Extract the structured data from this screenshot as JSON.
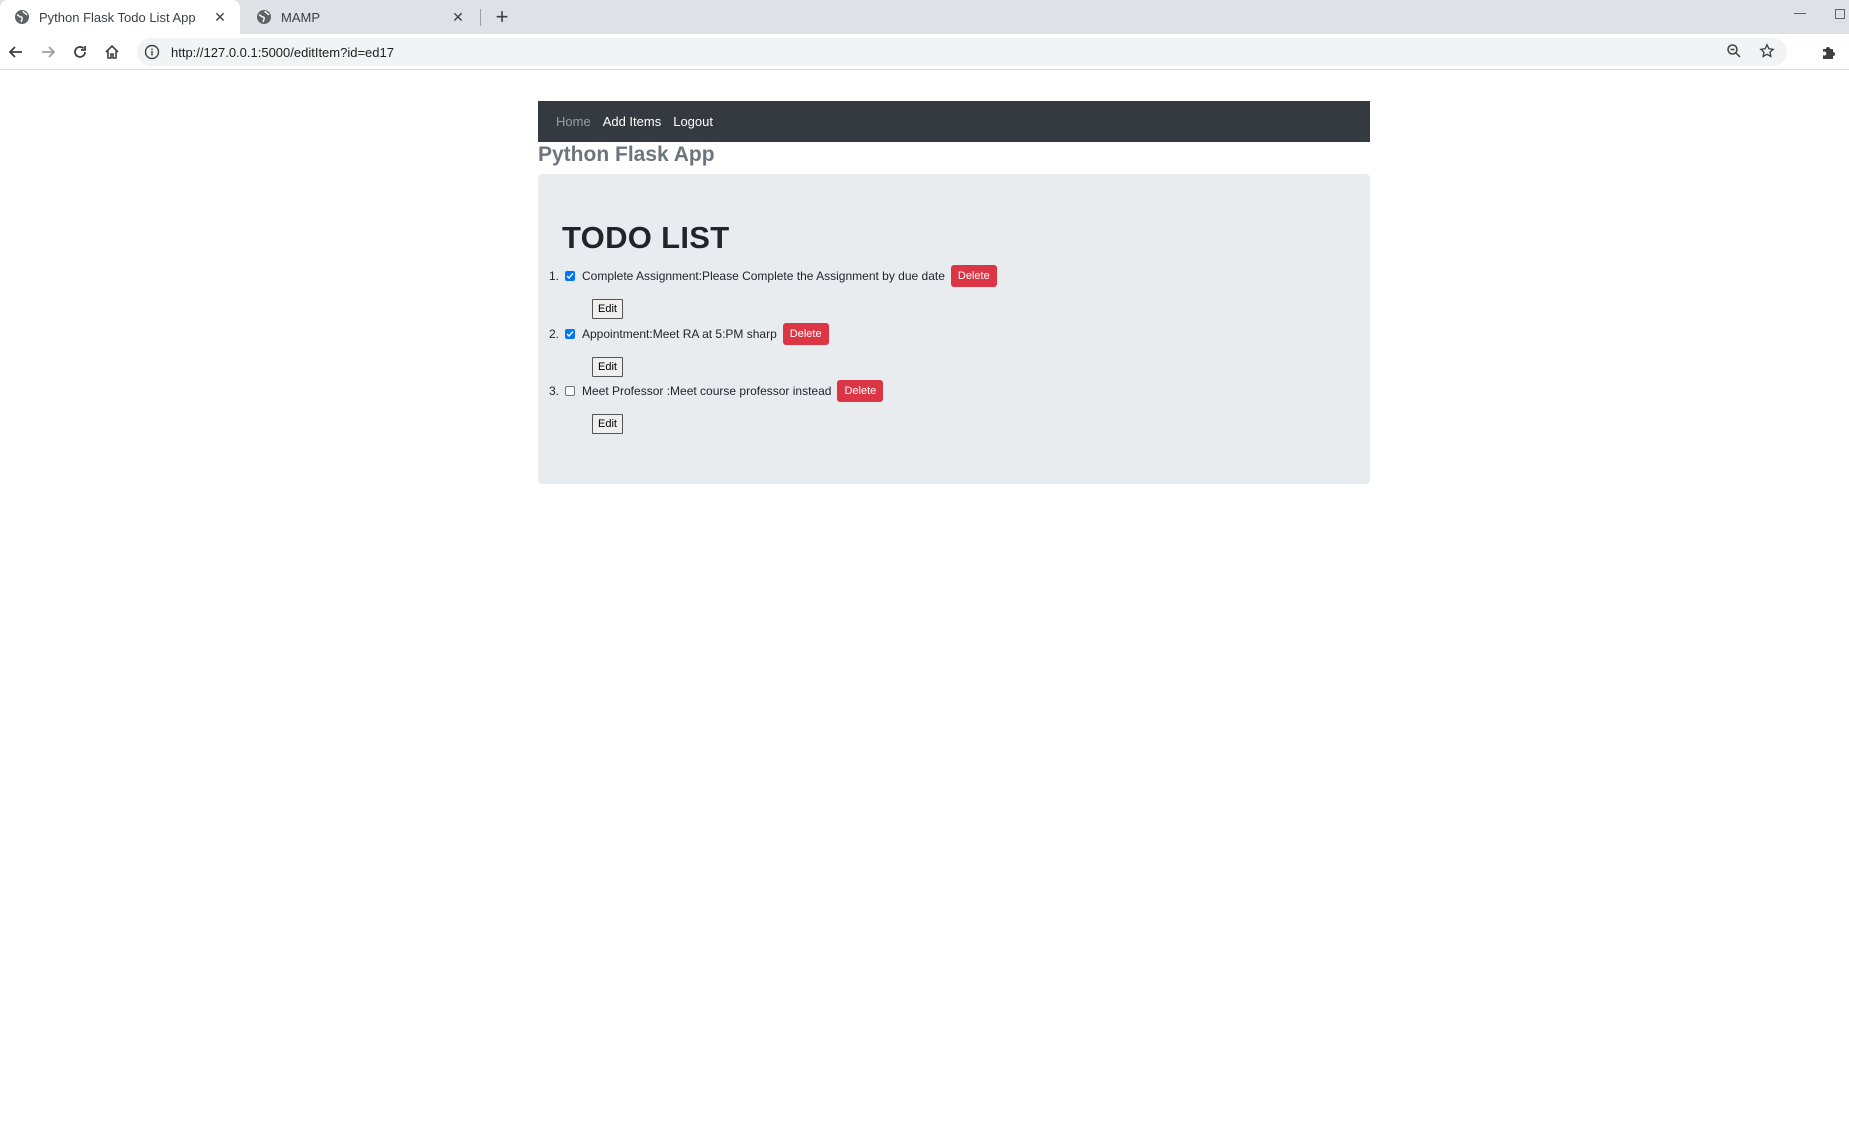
{
  "browser": {
    "tabs": [
      {
        "title": "Python Flask Todo List App",
        "active": true
      },
      {
        "title": "MAMP",
        "active": false
      }
    ],
    "address_bar": {
      "url": "http://127.0.0.1:5000/editItem?id=ed17"
    },
    "icons": [
      "back-arrow-icon",
      "forward-arrow-icon",
      "reload-icon",
      "home-icon",
      "info-icon",
      "zoom-icon",
      "star-icon",
      "extensions-puzzle-icon",
      "globe-icon",
      "close-icon",
      "plus-icon",
      "minimize-icon",
      "maximize-icon"
    ]
  },
  "navbar": {
    "home_label": "Home",
    "add_items_label": "Add Items",
    "logout_label": "Logout",
    "background_color": "#343a40"
  },
  "brand": {
    "title": "Python Flask App"
  },
  "todo": {
    "heading": "TODO LIST",
    "items": [
      {
        "number": "1.",
        "checked": true,
        "text": "Complete Assignment:Please Complete the Assignment by due date",
        "delete_label": "Delete",
        "edit_label": "Edit"
      },
      {
        "number": "2.",
        "checked": true,
        "text": "Appointment:Meet RA at 5:PM sharp",
        "delete_label": "Delete",
        "edit_label": "Edit"
      },
      {
        "number": "3.",
        "checked": false,
        "text": "Meet Professor :Meet course professor instead",
        "delete_label": "Delete",
        "edit_label": "Edit"
      }
    ]
  },
  "colors": {
    "delete_button": "#dc3545",
    "jumbotron_bg": "#e9ecef",
    "checkbox_checked": "#0075ff"
  }
}
